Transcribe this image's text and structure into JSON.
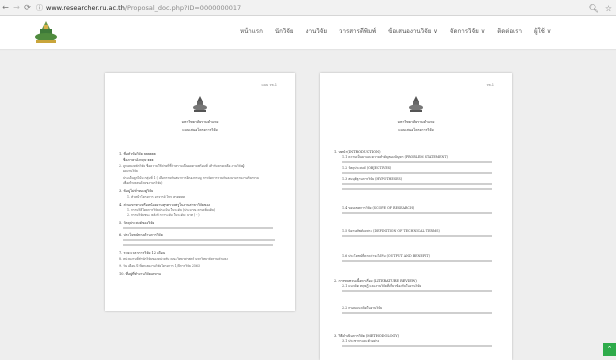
{
  "browser": {
    "back_icon": "arrow-left",
    "forward_icon": "arrow-right",
    "reload_icon": "reload",
    "url_host": "www.researcher.ru.ac.th",
    "url_path": "/Proposal_doc.php?ID=0000000017",
    "zoom_icon": "magnifier",
    "bookmark_icon": "star"
  },
  "site": {
    "menu": [
      "หน้าแรก",
      "นักวิจัย",
      "งานวิจัย",
      "วารสารตีพิมพ์",
      "ข้อเสนองานวิจัย ∨",
      "จัดการวิจัย ∨",
      "ติดต่อเรา",
      "ผู้ใช้ ∨"
    ]
  },
  "doc_left": {
    "page_label": "แบบ วช.1",
    "title1": "มหาวิทยาลัยรามคำแหง",
    "title2": "แบบเสนอโครงการวิจัย",
    "items": [
      "1. ชื่อหัวข้อวิจัย  xxxxxx",
      "ชื่อภาษาอังกฤษ  xxx",
      "2. ลูกเคยงหลักวิจัย  ชื่อความใช้จ่ายที่ชี้ว่าตรามเป็นผลตามพร้อมที่ เท้ากับลายเหลือ งานวิจัยผู้",
      "ผลงานวิจัย",
      "ประเด็นลูกไม้ม  กลุ่มที่ 1 ( เลือกรายกันสมาการอีกองกรมมู  การจัดการรวมกันลงนามรายงานกิจกรรม",
      "เพื่อเท้าเหลนด้วยขงานรวิจัย)",
      "3. ข้อมู่ไม่ท่ำทองคู่วิจัย",
      "1. หัวหน้าโครงการ อาจารย์ โทร ตรตตตต",
      "4. ส่วนเขาทางหรือหน้อยงานทุรตรวจพรูในงานสาขาวิจัยของ",
      "1. กรรมวิธีโดยการวิจัยประเมิน ในระดับ (ประมาณ ตามเพิ่มเติม)",
      "2. กรรมวิจัยชนะ หลังกั กวาระดับ ในระดับ: บาท ( - )",
      "5. วัตถุประสงค์ของวิจัย",
      "6. ประโยชน์ทางด้านการวิจัย",
      "7. ระยะเวลาการวิจัย   12  เดือน",
      "8. หน่วยงานที่สำนักวิจัยของหน่วยรับ  คณะวิทยาศาสตร์ มหาวิทยาลัยรามคำแหง",
      "9. วัน เดือน ปี ที่ยกเลยงานวิจัยโครงการ  1/ปีการวิจัย 2563",
      "10. ที่อยู่ที่ทำงานวิจัยเลขาน"
    ]
  },
  "doc_right": {
    "page_label": "วช.1",
    "title1": "มหาวิทยาลัยรามคำแหง",
    "title2": "แบบเสนอโครงการวิจัย",
    "sections": [
      "1. บทนำ(INTRODUCTION)",
      "1.1 ความเป็นมาและความสำคัญของปัญหา (PROBLEM STATEMENT)",
      "1.2 วัตถุประสงค์ (OBJECTIVES)",
      "1.3 สมมุติฐานการวิจัย (HYPOTHESES)",
      "1.4 ขอบเขตการวิจัย (SCOPE OF RESEARCH)",
      "1.5 นิยามศัพท์เฉพาะ (DEFINITION OF TECHNICAL TERMS)",
      "1.6 ประโยชน์ที่คาดว่าจะได้รับ (OUTPUT AND BENEFIT)",
      "2. การทบทวนเนื้อหาเรื่อง (LITERATURE REVIEW)",
      "2.1 แนวคิด ทฤษฎี และงานวิจัยที่เกี่ยวข้องกับในงานวิจัย",
      "2.2 กรอบแนวคิดในงานวิจัย",
      "3. วิธีดำเนินการวิจัย (METHODOLOGY)",
      "3.1 ประชากรและตัวอย่าง"
    ]
  },
  "colors": {
    "scroll_top_bg": "#2eab4a",
    "accent_red": "#c84b4b"
  },
  "scroll_top_icon": "chevron-up"
}
